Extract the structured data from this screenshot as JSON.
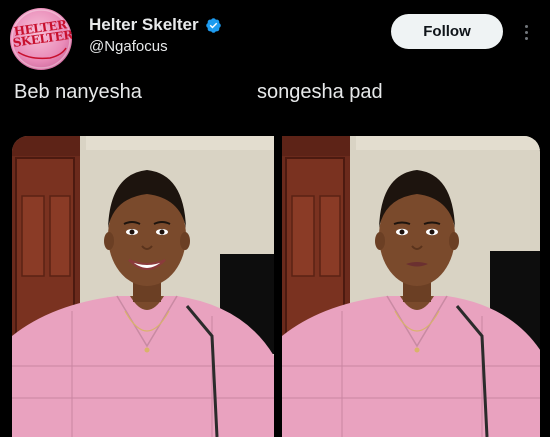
{
  "header": {
    "display_name": "Helter Skelter",
    "handle": "@Ngafocus",
    "follow_label": "Follow",
    "avatar_text": "HELTER SKELTER"
  },
  "tweet": {
    "caption_left": "Beb nanyesha",
    "caption_right": "songesha pad"
  },
  "colors": {
    "background": "#000000",
    "text": "#e7e9ea",
    "verified": "#1d9bf0",
    "follow_bg": "#eff3f4",
    "shirt": "#e9a2bf"
  },
  "icons": [
    "verified-badge-icon",
    "more-options-icon"
  ]
}
